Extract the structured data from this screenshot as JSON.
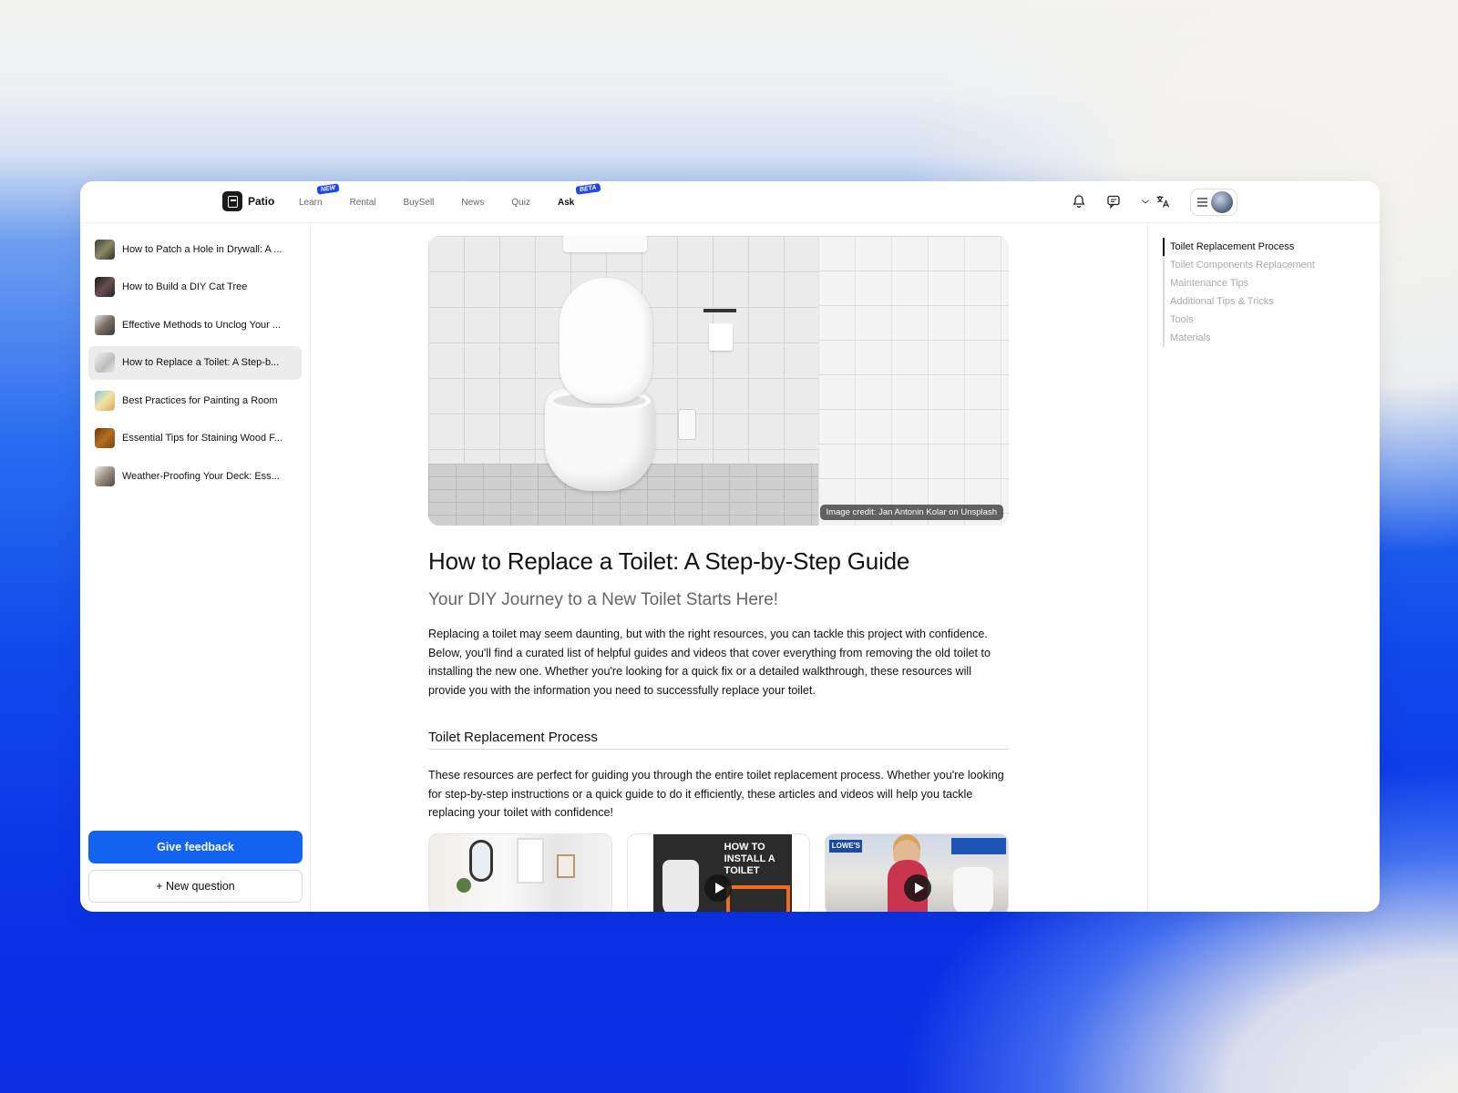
{
  "app": {
    "name": "Patio"
  },
  "nav": [
    {
      "label": "Learn",
      "badge": "NEW",
      "active": false
    },
    {
      "label": "Rental",
      "badge": null,
      "active": false
    },
    {
      "label": "BuySell",
      "badge": null,
      "active": false
    },
    {
      "label": "News",
      "badge": null,
      "active": false
    },
    {
      "label": "Quiz",
      "badge": null,
      "active": false
    },
    {
      "label": "Ask",
      "badge": "BETA",
      "active": true
    }
  ],
  "header_icons": [
    "bell-icon",
    "chat-icon",
    "chevron-down-icon",
    "translate-icon",
    "hamburger-icon"
  ],
  "sidebar": {
    "items": [
      {
        "label": "How to Patch a Hole in Drywall: A ...",
        "thumb": "#6b6a52"
      },
      {
        "label": "How to Build a DIY Cat Tree",
        "thumb": "#3b2f2f"
      },
      {
        "label": "Effective Methods to Unclog Your ...",
        "thumb": "#7a6d66"
      },
      {
        "label": "How to Replace a Toilet: A Step-b...",
        "thumb": "#c9c9c9"
      },
      {
        "label": "Best Practices for Painting a Room",
        "thumb": "#d9c27a"
      },
      {
        "label": "Essential Tips for Staining Wood F...",
        "thumb": "#a2621c"
      },
      {
        "label": "Weather-Proofing Your Deck: Ess...",
        "thumb": "#9a8d80"
      }
    ],
    "active_index": 3,
    "feedback_label": "Give feedback",
    "new_question_label": "+ New question"
  },
  "article": {
    "image_credit": "Image credit: Jan Antonin Kolar on Unsplash",
    "title": "How to Replace a Toilet: A Step-by-Step Guide",
    "subtitle": "Your DIY Journey to a New Toilet Starts Here!",
    "intro": "Replacing a toilet may seem daunting, but with the right resources, you can tackle this project with confidence. Below, you'll find a curated list of helpful guides and videos that cover everything from removing the old toilet to installing the new one. Whether you're looking for a quick fix or a detailed walkthrough, these resources will provide you with the information you need to successfully replace your toilet.",
    "section_title": "Toilet Replacement Process",
    "section_body": "These resources are perfect for guiding you through the entire toilet replacement process. Whether you're looking for step-by-step instructions or a quick guide to do it efficiently, these articles and videos will help you tackle replacing your toilet with confidence!",
    "cards": [
      {
        "type": "article"
      },
      {
        "type": "video",
        "overlay_text": "HOW TO INSTALL A TOILET"
      },
      {
        "type": "video",
        "sign_text": "LOWE'S"
      }
    ]
  },
  "toc": {
    "items": [
      "Toilet Replacement Process",
      "Toilet Components Replacement",
      "Maintenance Tips",
      "Additional Tips & Tricks",
      "Tools",
      "Materials"
    ],
    "active_index": 0
  }
}
